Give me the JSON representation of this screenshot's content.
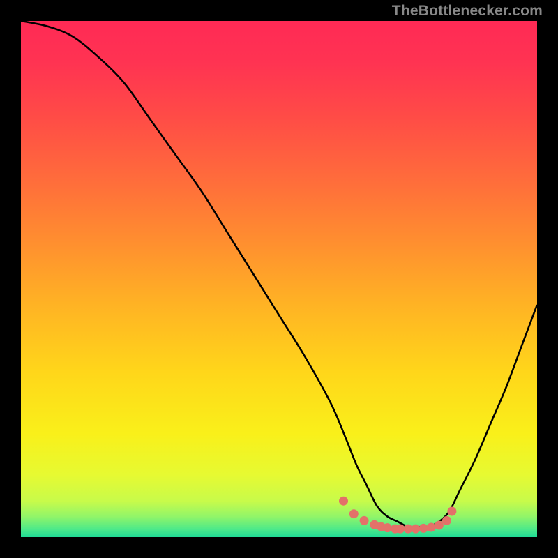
{
  "attribution": "TheBottlenecker.com",
  "chart_data": {
    "type": "line",
    "title": "",
    "xlabel": "",
    "ylabel": "",
    "xlim": [
      0,
      100
    ],
    "ylim": [
      0,
      100
    ],
    "series": [
      {
        "name": "curve",
        "x": [
          0,
          5,
          10,
          15,
          20,
          25,
          30,
          35,
          40,
          45,
          50,
          55,
          60,
          63,
          65,
          67,
          69,
          71,
          73,
          75,
          77,
          79,
          81,
          83,
          85,
          88,
          91,
          94,
          97,
          100
        ],
        "y": [
          100,
          99,
          97,
          93,
          88,
          81,
          74,
          67,
          59,
          51,
          43,
          35,
          26,
          19,
          14,
          10,
          6,
          4,
          3,
          2,
          2,
          2,
          3,
          5,
          9,
          15,
          22,
          29,
          37,
          45
        ]
      },
      {
        "name": "markers",
        "x": [
          62.5,
          64.5,
          66.5,
          68.5,
          69.8,
          71.0,
          72.5,
          73.5,
          75.0,
          76.5,
          78.0,
          79.5,
          81.0,
          82.5,
          83.5
        ],
        "y": [
          7.0,
          4.5,
          3.2,
          2.4,
          2.0,
          1.8,
          1.6,
          1.6,
          1.6,
          1.6,
          1.7,
          1.9,
          2.3,
          3.2,
          5.0
        ]
      }
    ],
    "gradient_stops": [
      {
        "offset": 0.0,
        "color": "#ff2a55"
      },
      {
        "offset": 0.08,
        "color": "#ff3352"
      },
      {
        "offset": 0.18,
        "color": "#ff4a47"
      },
      {
        "offset": 0.3,
        "color": "#ff6a3c"
      },
      {
        "offset": 0.42,
        "color": "#ff8c30"
      },
      {
        "offset": 0.55,
        "color": "#ffb324"
      },
      {
        "offset": 0.68,
        "color": "#ffd61a"
      },
      {
        "offset": 0.8,
        "color": "#f9f01a"
      },
      {
        "offset": 0.88,
        "color": "#e6fa32"
      },
      {
        "offset": 0.93,
        "color": "#c8fb4a"
      },
      {
        "offset": 0.96,
        "color": "#92f568"
      },
      {
        "offset": 0.985,
        "color": "#4ce98a"
      },
      {
        "offset": 1.0,
        "color": "#1fdb95"
      }
    ],
    "curve_color": "#000000",
    "marker_color": "#e37169",
    "plot_bg": "gradient",
    "frame_bg": "#000000"
  }
}
